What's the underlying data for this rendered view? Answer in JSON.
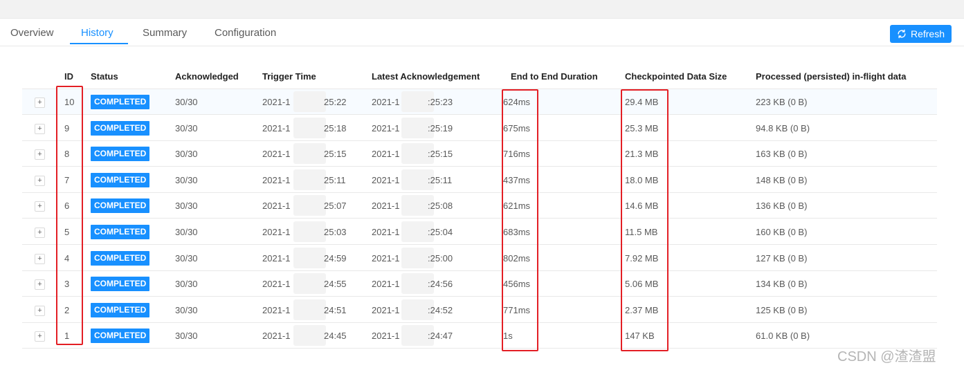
{
  "tabs": [
    {
      "label": "Overview",
      "active": false
    },
    {
      "label": "History",
      "active": true
    },
    {
      "label": "Summary",
      "active": false
    },
    {
      "label": "Configuration",
      "active": false
    }
  ],
  "refresh": {
    "label": "Refresh",
    "icon": "refresh-icon"
  },
  "colors": {
    "accent": "#1890ff",
    "highlight_border": "#e31e24"
  },
  "table": {
    "columns": [
      "ID",
      "Status",
      "Acknowledged",
      "Trigger Time",
      "Latest Acknowledgement",
      "End to End Duration",
      "Checkpointed Data Size",
      "Processed (persisted) in-flight data"
    ],
    "rows": [
      {
        "id": "10",
        "status": "COMPLETED",
        "ack": "30/30",
        "trigger_prefix": "2021-1",
        "trigger_suffix": "25:22",
        "latest_prefix": "2021-1",
        "latest_suffix": ":25:23",
        "duration": "624ms",
        "size": "29.4 MB",
        "inflight": "223 KB (0 B)"
      },
      {
        "id": "9",
        "status": "COMPLETED",
        "ack": "30/30",
        "trigger_prefix": "2021-1",
        "trigger_suffix": "25:18",
        "latest_prefix": "2021-1",
        "latest_suffix": ":25:19",
        "duration": "675ms",
        "size": "25.3 MB",
        "inflight": "94.8 KB (0 B)"
      },
      {
        "id": "8",
        "status": "COMPLETED",
        "ack": "30/30",
        "trigger_prefix": "2021-1",
        "trigger_suffix": "25:15",
        "latest_prefix": "2021-1",
        "latest_suffix": ":25:15",
        "duration": "716ms",
        "size": "21.3 MB",
        "inflight": "163 KB (0 B)"
      },
      {
        "id": "7",
        "status": "COMPLETED",
        "ack": "30/30",
        "trigger_prefix": "2021-1",
        "trigger_suffix": "25:11",
        "latest_prefix": "2021-1",
        "latest_suffix": ":25:11",
        "duration": "437ms",
        "size": "18.0 MB",
        "inflight": "148 KB (0 B)"
      },
      {
        "id": "6",
        "status": "COMPLETED",
        "ack": "30/30",
        "trigger_prefix": "2021-1",
        "trigger_suffix": "25:07",
        "latest_prefix": "2021-1",
        "latest_suffix": ":25:08",
        "duration": "621ms",
        "size": "14.6 MB",
        "inflight": "136 KB (0 B)"
      },
      {
        "id": "5",
        "status": "COMPLETED",
        "ack": "30/30",
        "trigger_prefix": "2021-1",
        "trigger_suffix": "25:03",
        "latest_prefix": "2021-1",
        "latest_suffix": ":25:04",
        "duration": "683ms",
        "size": "11.5 MB",
        "inflight": "160 KB (0 B)"
      },
      {
        "id": "4",
        "status": "COMPLETED",
        "ack": "30/30",
        "trigger_prefix": "2021-1",
        "trigger_suffix": "24:59",
        "latest_prefix": "2021-1",
        "latest_suffix": ":25:00",
        "duration": "802ms",
        "size": "7.92 MB",
        "inflight": "127 KB (0 B)"
      },
      {
        "id": "3",
        "status": "COMPLETED",
        "ack": "30/30",
        "trigger_prefix": "2021-1",
        "trigger_suffix": "24:55",
        "latest_prefix": "2021-1",
        "latest_suffix": ":24:56",
        "duration": "456ms",
        "size": "5.06 MB",
        "inflight": "134 KB (0 B)"
      },
      {
        "id": "2",
        "status": "COMPLETED",
        "ack": "30/30",
        "trigger_prefix": "2021-1",
        "trigger_suffix": "24:51",
        "latest_prefix": "2021-1",
        "latest_suffix": ":24:52",
        "duration": "771ms",
        "size": "2.37 MB",
        "inflight": "125 KB (0 B)"
      },
      {
        "id": "1",
        "status": "COMPLETED",
        "ack": "30/30",
        "trigger_prefix": "2021-1",
        "trigger_suffix": "24:45",
        "latest_prefix": "2021-1",
        "latest_suffix": ":24:47",
        "duration": "1s",
        "size": "147 KB",
        "inflight": "61.0 KB (0 B)"
      }
    ]
  },
  "watermark": "CSDN @渣渣盟"
}
